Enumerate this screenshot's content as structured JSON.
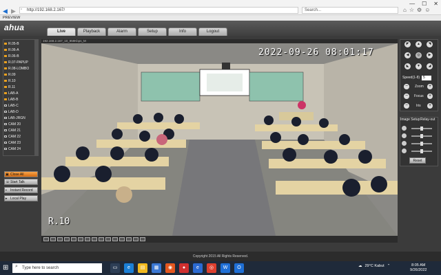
{
  "browser": {
    "url": "http://192.168.2.167/",
    "search_placeholder": "Search...",
    "tab_title": "PREVIEW"
  },
  "app": {
    "logo": "alhua",
    "logo_prefix": "a",
    "tabs": [
      {
        "label": "Live"
      },
      {
        "label": "Playback"
      },
      {
        "label": "Alarm"
      },
      {
        "label": "Setup"
      },
      {
        "label": "Info"
      },
      {
        "label": "Logout"
      }
    ],
    "active_tab": "Live",
    "footer": "Copyright 2015 All Rights Reserved."
  },
  "sidebar": {
    "cameras": [
      {
        "label": "R.05-B",
        "m": "M"
      },
      {
        "label": "R.06-A",
        "m": "M"
      },
      {
        "label": "R.06-B",
        "m": "M"
      },
      {
        "label": "R.07-PAPUP",
        "m": "M"
      },
      {
        "label": "R.08-LOMBO",
        "m": "M"
      },
      {
        "label": "R.09",
        "m": "M"
      },
      {
        "label": "R.10",
        "m": "M"
      },
      {
        "label": "R.11",
        "m": "M"
      },
      {
        "label": "LAB-A",
        "m": "M"
      },
      {
        "label": "LAB-B",
        "m": "M"
      },
      {
        "label": "LAB-C",
        "m": ""
      },
      {
        "label": "LAB-D",
        "m": ""
      },
      {
        "label": "LAB-JRGN",
        "m": ""
      },
      {
        "label": "CAM 20",
        "m": ""
      },
      {
        "label": "CAM 21",
        "m": ""
      },
      {
        "label": "CAM 22",
        "m": ""
      },
      {
        "label": "CAM 23",
        "m": ""
      },
      {
        "label": "CAM 24",
        "m": ""
      }
    ],
    "buttons": {
      "close_all": "Close All",
      "start_talk": "Start Talk",
      "instant_record": "Instant Record",
      "local_play": "Local Play"
    }
  },
  "video": {
    "header": "192.168.2.167_10_959Kbps_M",
    "timestamp": "2022-09-26 08:01:17",
    "channel_name": "R.10"
  },
  "ptz": {
    "speed_label": "Speed(1-8)",
    "speed_value": "5",
    "zoom_label": "Zoom",
    "focus_label": "Focus",
    "iris_label": "Iris",
    "image_setup_label": "Image Setup",
    "relay_out_label": "Relay-out",
    "reset_label": "Reset"
  },
  "taskbar": {
    "search_placeholder": "Type here to search",
    "weather": "29°C  Kabut",
    "time": "8:05 AM",
    "date": "9/26/2022"
  }
}
